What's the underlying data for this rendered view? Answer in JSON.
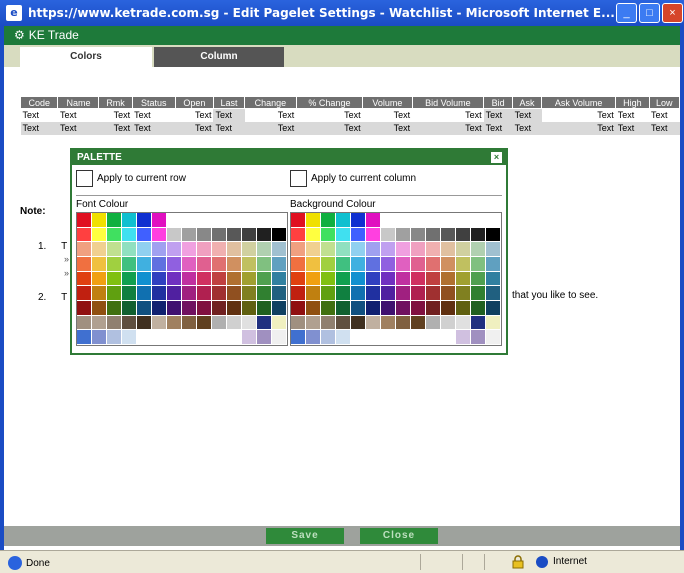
{
  "window": {
    "title": "https://www.ketrade.com.sg - Edit Pagelet Settings - Watchlist - Microsoft Internet E...",
    "minimize_glyph": "_",
    "maximize_glyph": "□",
    "close_glyph": "×"
  },
  "app": {
    "name": "KE Trade"
  },
  "tabs": [
    {
      "label": "Colors",
      "active": true
    },
    {
      "label": "Column",
      "active": false
    }
  ],
  "table": {
    "headers": [
      "Code",
      "Name",
      "Rmk",
      "Status",
      "Open",
      "Last",
      "Change",
      "% Change",
      "Volume",
      "Bid Volume",
      "Bid",
      "Ask",
      "Ask Volume",
      "High",
      "Low"
    ],
    "rows": [
      [
        "Text",
        "Text",
        "Text",
        "Text",
        "Text",
        "Text",
        "Text",
        "Text",
        "Text",
        "Text",
        "Text",
        "Text",
        "Text",
        "Text",
        "Text"
      ],
      [
        "Text",
        "Text",
        "Text",
        "Text",
        "Text",
        "Text",
        "Text",
        "Text",
        "Text",
        "Text",
        "Text",
        "Text",
        "Text",
        "Text",
        "Text"
      ]
    ]
  },
  "note": {
    "label": "Note:",
    "items": [
      {
        "num": "1.",
        "text": "T"
      },
      {
        "num": "2.",
        "text": "T"
      }
    ],
    "bullets": [
      "»",
      "»"
    ],
    "partial_text": "that you like to see."
  },
  "palette": {
    "title": "PALETTE",
    "close_glyph": "×",
    "apply_row": "Apply to current row",
    "apply_column": "Apply to current column",
    "font_colour_label": "Font Colour",
    "background_colour_label": "Background Colour",
    "colors": [
      [
        "#e01020",
        "#f0e000",
        "#10b040",
        "#10c0d0",
        "#1030d0",
        "#e010c0",
        "#ffffff",
        "#ffffff",
        "#ffffff",
        "#ffffff",
        "#ffffff",
        "#ffffff",
        "#ffffff",
        "#ffffff"
      ],
      [
        "#ff4040",
        "#ffff40",
        "#40e060",
        "#40e0f0",
        "#4060ff",
        "#ff40e0",
        "#c8c8c8",
        "#a0a0a0",
        "#888888",
        "#707070",
        "#585858",
        "#404040",
        "#202020",
        "#000000"
      ],
      [
        "#f0a080",
        "#f0d090",
        "#c0e090",
        "#90e0c0",
        "#90d0f0",
        "#a0a0f0",
        "#c0a0f0",
        "#f0a0e0",
        "#f0a0c0",
        "#f0b0b0",
        "#e0c0a0",
        "#d0d0a0",
        "#b0d0b0",
        "#a0c0d0"
      ],
      [
        "#f07040",
        "#f0c040",
        "#a0d040",
        "#40c080",
        "#40b0e0",
        "#6070e0",
        "#9060e0",
        "#e060c0",
        "#e06090",
        "#e07070",
        "#d09060",
        "#c0c060",
        "#80c080",
        "#60a0c0"
      ],
      [
        "#e04010",
        "#f0a010",
        "#80c010",
        "#10a050",
        "#1090d0",
        "#3040c0",
        "#7030c0",
        "#c030a0",
        "#d03060",
        "#c04040",
        "#b07030",
        "#a0a030",
        "#50a050",
        "#3080a0"
      ],
      [
        "#c02010",
        "#c08010",
        "#60a010",
        "#108040",
        "#1070b0",
        "#2030a0",
        "#5020a0",
        "#a02080",
        "#b02050",
        "#a03030",
        "#905020",
        "#808020",
        "#308030",
        "#206080"
      ],
      [
        "#901010",
        "#905010",
        "#407010",
        "#106030",
        "#105080",
        "#102070",
        "#401070",
        "#701060",
        "#801040",
        "#702020",
        "#603010",
        "#606010",
        "#206020",
        "#104060"
      ],
      [
        "#a09080",
        "#b0a090",
        "#908070",
        "#605040",
        "#403020",
        "#c0b0a0",
        "#a08060",
        "#806040",
        "#604020",
        "#b0b0b0",
        "#d0d0d0",
        "#e0e0e0",
        "#203080",
        "#f0f0c0"
      ],
      [
        "#4070d0",
        "#8090d0",
        "#b0c0e0",
        "#d0e0f0",
        "#ffffff",
        "#ffffff",
        "#ffffff",
        "#ffffff",
        "#ffffff",
        "#ffffff",
        "#ffffff",
        "#d0c0e0",
        "#a090c0",
        "#f0f0f0"
      ]
    ]
  },
  "buttons": {
    "save": "Save",
    "close": "Close"
  },
  "status": {
    "done": "Done",
    "zone": "Internet"
  }
}
